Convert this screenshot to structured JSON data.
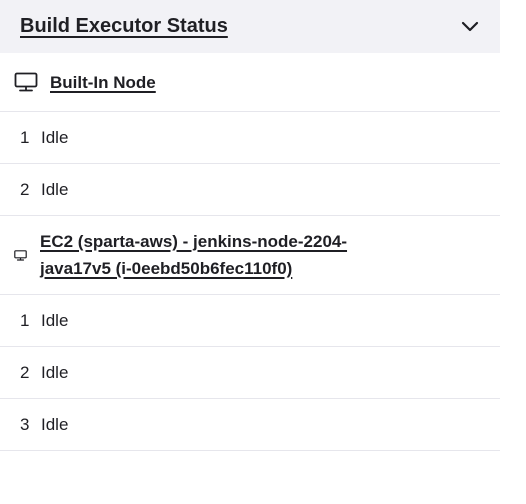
{
  "header": {
    "title": "Build Executor Status",
    "collapse_icon": "chevron-down-icon"
  },
  "nodes": [
    {
      "name": "Built-In Node",
      "icon": "computer-icon",
      "executors": [
        {
          "number": "1",
          "status": "Idle"
        },
        {
          "number": "2",
          "status": "Idle"
        }
      ]
    },
    {
      "name": "EC2 (sparta-aws) - jenkins-node-2204-java17v5 (i-0eebd50b6fec110f0)",
      "icon": "computer-icon",
      "executors": [
        {
          "number": "1",
          "status": "Idle"
        },
        {
          "number": "2",
          "status": "Idle"
        },
        {
          "number": "3",
          "status": "Idle"
        }
      ]
    }
  ]
}
